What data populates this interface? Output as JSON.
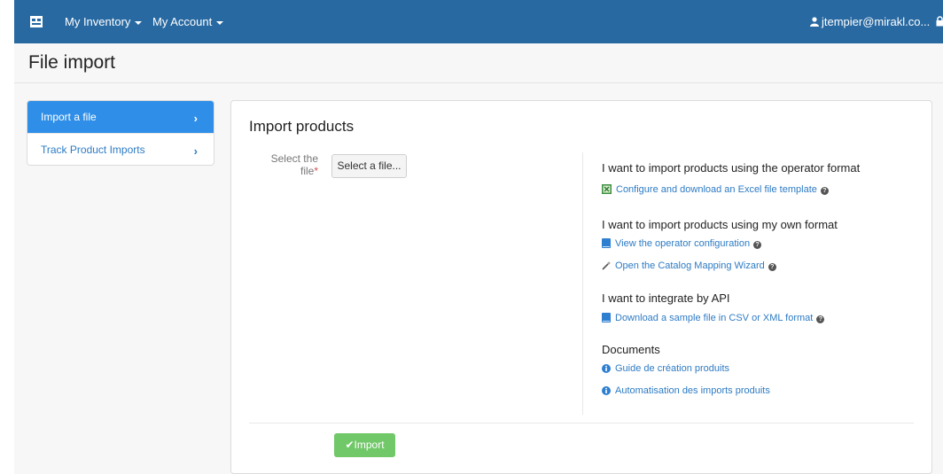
{
  "topbar": {
    "menus": [
      {
        "label": "My Inventory"
      },
      {
        "label": "My Account"
      }
    ],
    "user": "jtempier@mirakl.co..."
  },
  "page": {
    "title": "File import"
  },
  "sidebar": {
    "items": [
      {
        "label": "Import a file",
        "active": true
      },
      {
        "label": "Track Product Imports",
        "active": false
      }
    ]
  },
  "panel": {
    "title": "Import products",
    "field_label": "Select the file",
    "required_mark": "*",
    "file_button": "Select a file...",
    "sections": [
      {
        "title": "I want to import products using the operator format",
        "links": [
          {
            "label": "Configure and download an Excel file template",
            "icon": "excel-icon"
          }
        ]
      },
      {
        "title": "I want to import products using my own format",
        "links": [
          {
            "label": "View the operator configuration",
            "icon": "book-icon"
          },
          {
            "label": "Open the Catalog Mapping Wizard",
            "icon": "wand-icon"
          }
        ]
      },
      {
        "title": "I want to integrate by API",
        "links": [
          {
            "label": "Download a sample file in CSV or XML format",
            "icon": "book-icon"
          }
        ]
      },
      {
        "title": "Documents",
        "links": [
          {
            "label": "Guide de création produits",
            "icon": "info-icon"
          },
          {
            "label": "Automatisation des imports produits",
            "icon": "info-icon"
          }
        ]
      }
    ],
    "import_button": "Import"
  },
  "colors": {
    "topbar": "#2869a2",
    "accent": "#2f8fe8",
    "link": "#2d7bc4",
    "success": "#70c868"
  }
}
